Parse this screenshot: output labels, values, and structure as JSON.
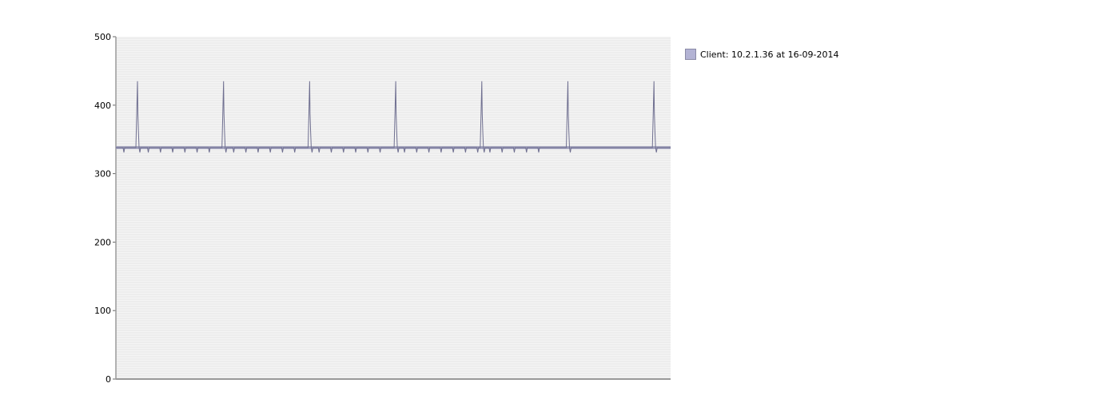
{
  "chart_data": {
    "type": "line",
    "y_ticks": [
      "0",
      "100",
      "200",
      "300",
      "400",
      "500"
    ],
    "ylim": [
      0,
      500
    ],
    "grid": true,
    "legend_placement": "right",
    "colors": {
      "line": "#6f6f90",
      "band": "#9a9ab8",
      "swatch": "#b3b3d4",
      "plot_bg": "#f4f4f4",
      "grid": "#e6e6e6"
    },
    "series": [
      {
        "name": "Client: 10.2.1.36 at 16-09-2014",
        "baseline": 338,
        "min_dip": 331,
        "spike_peak": 435,
        "spike_count": 7,
        "small_dip_count": 35
      }
    ]
  }
}
